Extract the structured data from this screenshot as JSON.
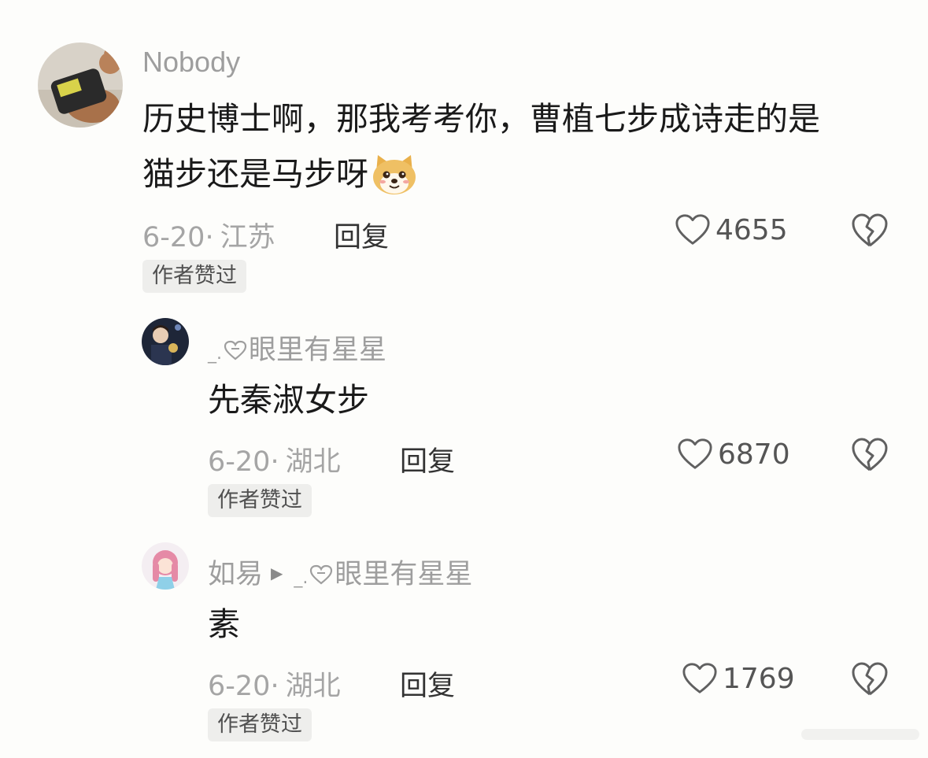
{
  "comments": [
    {
      "username": "Nobody",
      "text_line1": "历史博士啊，那我考考你，曹植七步成诗走的是",
      "text_line2": "猫步还是马步呀",
      "emoji": "doge-emoji",
      "date": "6-20",
      "dot": "·",
      "location": "江苏",
      "reply_label": "回复",
      "likes": "4655",
      "badge": "作者赞过"
    },
    {
      "username_prefix": "_.",
      "username_name": "眼里有星星",
      "text": "先秦淑女步",
      "date": "6-20",
      "dot": "·",
      "location": "湖北",
      "reply_label": "回复",
      "likes": "6870",
      "badge": "作者赞过"
    },
    {
      "username": "如易",
      "reply_to_prefix": "_.",
      "reply_to_name": "眼里有星星",
      "text": "素",
      "date": "6-20",
      "dot": "·",
      "location": "湖北",
      "reply_label": "回复",
      "likes": "1769",
      "badge": "作者赞过"
    }
  ],
  "icons": {
    "like": "heart-outline-icon",
    "dislike": "broken-heart-icon",
    "reply_arrow": "play-arrow-icon"
  },
  "colors": {
    "background": "#fdfdfb",
    "muted_text": "#9e9e9e",
    "badge_bg": "#eeeeec"
  }
}
